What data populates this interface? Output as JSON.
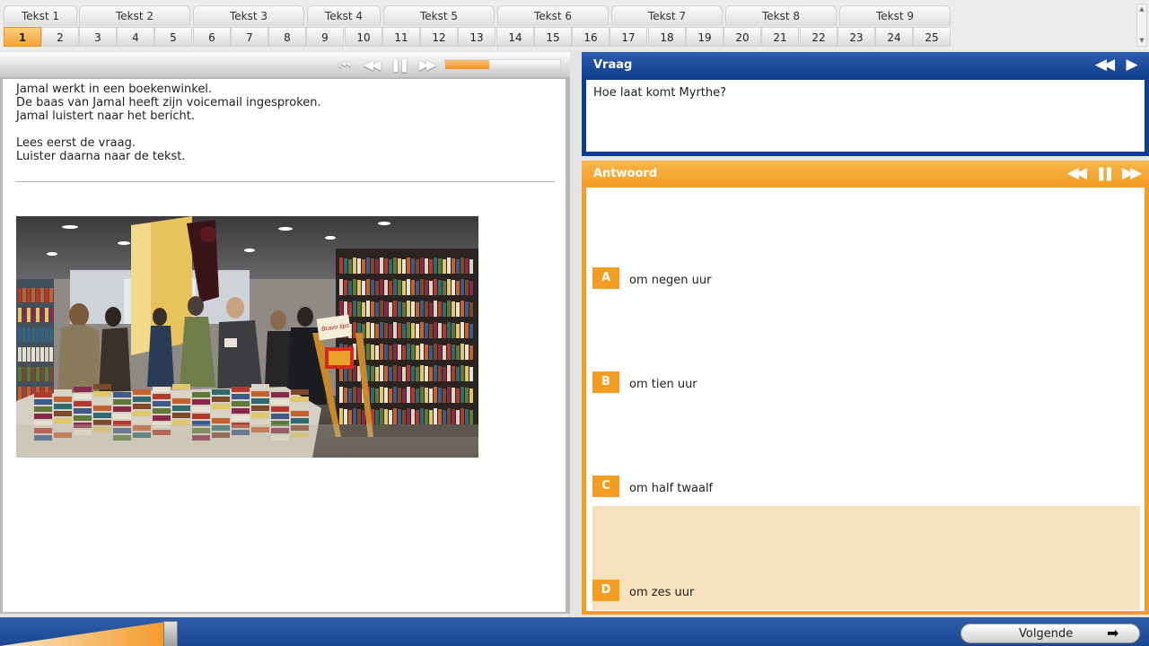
{
  "topnav": {
    "tabs": [
      {
        "label": "Tekst 1",
        "active": true
      },
      {
        "label": "Tekst 2",
        "active": false
      },
      {
        "label": "Tekst 3",
        "active": false
      },
      {
        "label": "Tekst 4",
        "active": false
      },
      {
        "label": "Tekst 5",
        "active": false
      },
      {
        "label": "Tekst 6",
        "active": false
      },
      {
        "label": "Tekst 7",
        "active": false
      },
      {
        "label": "Tekst 8",
        "active": false
      },
      {
        "label": "Tekst 9",
        "active": false
      }
    ],
    "numbers": [
      "1",
      "2",
      "3",
      "4",
      "5",
      "6",
      "7",
      "8",
      "9",
      "10",
      "11",
      "12",
      "13",
      "14",
      "15",
      "16",
      "17",
      "18",
      "19",
      "20",
      "21",
      "22",
      "23",
      "24",
      "25"
    ],
    "active_number": "1",
    "scroll_up_icon": "▲",
    "scroll_down_icon": "▼"
  },
  "left": {
    "audio": {
      "first_icon": "⏮",
      "rewind_icon": "◀◀",
      "pause_icon": "❚❚",
      "forward_icon": "▶▶",
      "progress": 0.38
    },
    "intro_lines": [
      "Jamal werkt in een boekenwinkel.",
      "De baas van Jamal heeft zijn voicemail ingesproken.",
      "Jamal luistert naar het bericht.",
      "",
      "Lees eerst de vraag.",
      "Luister daarna naar de tekst."
    ],
    "photo_icon": "bookstore-photo",
    "sign_text": "Bravo tips"
  },
  "question": {
    "title": "Vraag",
    "first_icon": "◀◀",
    "play_icon": "▶",
    "text": "Hoe laat komt Myrthe?"
  },
  "answer": {
    "title": "Antwoord",
    "rewind_icon": "◀◀",
    "pause_icon": "❚❚",
    "forward_icon": "▶▶",
    "options": [
      {
        "letter": "A",
        "text": "om negen uur",
        "selected": false
      },
      {
        "letter": "B",
        "text": "om tien uur",
        "selected": false
      },
      {
        "letter": "C",
        "text": "om half twaalf",
        "selected": false
      },
      {
        "letter": "D",
        "text": "om zes uur",
        "selected": true
      }
    ]
  },
  "footer": {
    "progress": 0.04,
    "next_label": "Volgende",
    "next_icon": "➡"
  },
  "colors": {
    "accent_orange": "#f39d22",
    "primary_blue": "#0f3f8c",
    "selected_answer_bg": "#f7e0bc"
  }
}
